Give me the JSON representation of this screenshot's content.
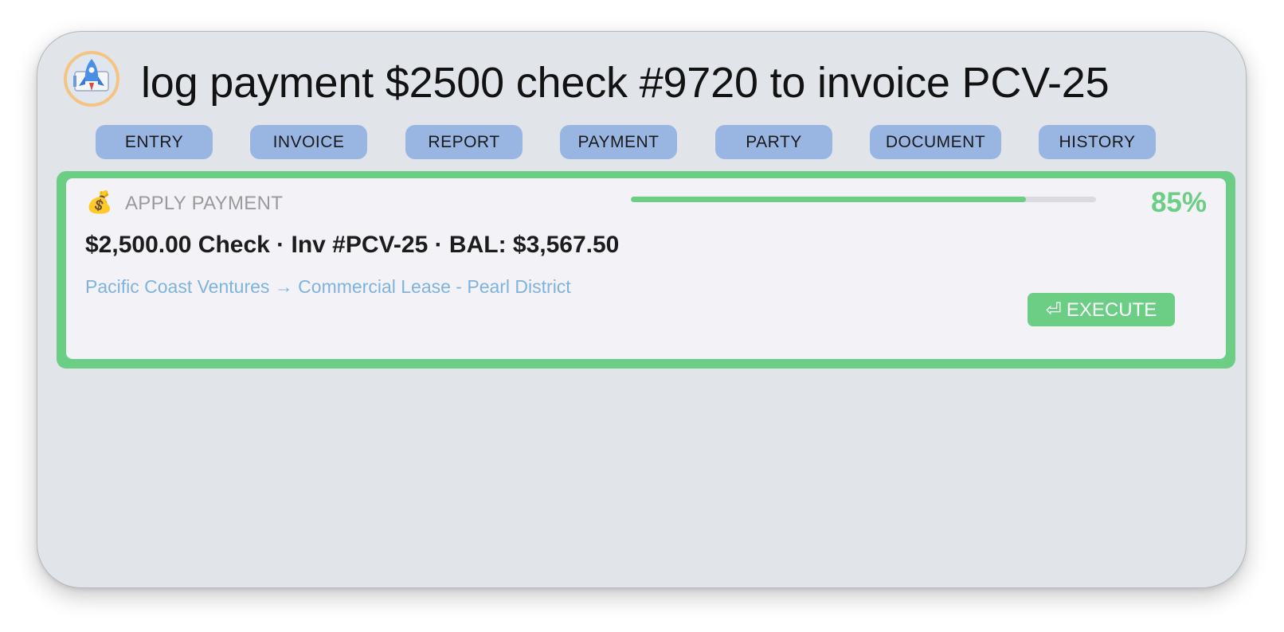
{
  "query": "log payment $2500 check #9720 to invoice PCV-25",
  "tabs": [
    "ENTRY",
    "INVOICE",
    "REPORT",
    "PAYMENT",
    "PARTY",
    "DOCUMENT",
    "HISTORY"
  ],
  "result": {
    "category_icon": "money-bag-icon",
    "category_emoji": "💰",
    "category": "APPLY PAYMENT",
    "confidence_label": "85%",
    "confidence_fraction": 0.85,
    "summary": "$2,500.00 Check · Inv #PCV-25 · BAL: $3,567.50",
    "path": "Pacific Coast Ventures → Commercial Lease - Pearl District",
    "execute_icon": "return-arrow-icon",
    "execute_symbol": "⏎",
    "execute_label": "EXECUTE"
  },
  "colors": {
    "accent_green": "#6ccd85",
    "tab_blue": "#99b6e3",
    "link_blue": "#7fb2dc",
    "window_bg": "#e1e5e9"
  }
}
